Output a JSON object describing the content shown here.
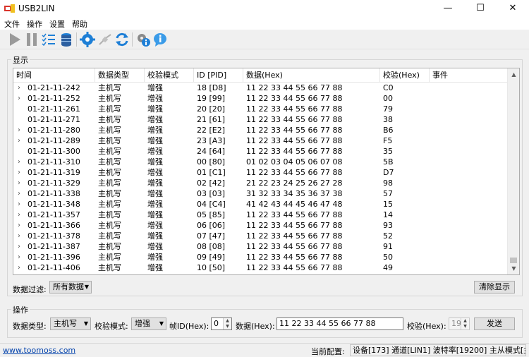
{
  "window": {
    "title": "USB2LIN",
    "minimize": "—",
    "maximize": "☐",
    "close": "✕"
  },
  "menu": [
    "文件",
    "操作",
    "设置",
    "帮助"
  ],
  "toolbar_icons": [
    "play-icon",
    "pause-icon",
    "list-icon",
    "database-icon",
    "gear-icon",
    "plugin-icon",
    "refresh-icon",
    "config-info-icon",
    "about-icon"
  ],
  "display_group": {
    "title": "显示"
  },
  "table": {
    "columns": [
      "时间",
      "数据类型",
      "校验模式",
      "ID [PID]",
      "数据(Hex)",
      "校验(Hex)",
      "事件"
    ],
    "rows": [
      {
        "expandable": true,
        "time": "01-21-11-242",
        "type": "主机写",
        "mode": "增强",
        "id": "18 [D8]",
        "data": "11 22 33 44 55 66 77 88",
        "check": "C0",
        "event": ""
      },
      {
        "expandable": true,
        "time": "01-21-11-252",
        "type": "主机写",
        "mode": "增强",
        "id": "19 [99]",
        "data": "11 22 33 44 55 66 77 88",
        "check": "00",
        "event": ""
      },
      {
        "expandable": false,
        "time": "01-21-11-261",
        "type": "主机写",
        "mode": "增强",
        "id": "20 [20]",
        "data": "11 22 33 44 55 66 77 88",
        "check": "79",
        "event": ""
      },
      {
        "expandable": false,
        "time": "01-21-11-271",
        "type": "主机写",
        "mode": "增强",
        "id": "21 [61]",
        "data": "11 22 33 44 55 66 77 88",
        "check": "38",
        "event": ""
      },
      {
        "expandable": true,
        "time": "01-21-11-280",
        "type": "主机写",
        "mode": "增强",
        "id": "22 [E2]",
        "data": "11 22 33 44 55 66 77 88",
        "check": "B6",
        "event": ""
      },
      {
        "expandable": true,
        "time": "01-21-11-289",
        "type": "主机写",
        "mode": "增强",
        "id": "23 [A3]",
        "data": "11 22 33 44 55 66 77 88",
        "check": "F5",
        "event": ""
      },
      {
        "expandable": false,
        "time": "01-21-11-300",
        "type": "主机写",
        "mode": "增强",
        "id": "24 [64]",
        "data": "11 22 33 44 55 66 77 88",
        "check": "35",
        "event": ""
      },
      {
        "expandable": true,
        "time": "01-21-11-310",
        "type": "主机写",
        "mode": "增强",
        "id": "00 [80]",
        "data": "01 02 03 04 05 06 07 08",
        "check": "5B",
        "event": ""
      },
      {
        "expandable": true,
        "time": "01-21-11-319",
        "type": "主机写",
        "mode": "增强",
        "id": "01 [C1]",
        "data": "11 22 33 44 55 66 77 88",
        "check": "D7",
        "event": ""
      },
      {
        "expandable": true,
        "time": "01-21-11-329",
        "type": "主机写",
        "mode": "增强",
        "id": "02 [42]",
        "data": "21 22 23 24 25 26 27 28",
        "check": "98",
        "event": ""
      },
      {
        "expandable": true,
        "time": "01-21-11-338",
        "type": "主机写",
        "mode": "增强",
        "id": "03 [03]",
        "data": "31 32 33 34 35 36 37 38",
        "check": "57",
        "event": ""
      },
      {
        "expandable": true,
        "time": "01-21-11-348",
        "type": "主机写",
        "mode": "增强",
        "id": "04 [C4]",
        "data": "41 42 43 44 45 46 47 48",
        "check": "15",
        "event": ""
      },
      {
        "expandable": true,
        "time": "01-21-11-357",
        "type": "主机写",
        "mode": "增强",
        "id": "05 [85]",
        "data": "11 22 33 44 55 66 77 88",
        "check": "14",
        "event": ""
      },
      {
        "expandable": true,
        "time": "01-21-11-366",
        "type": "主机写",
        "mode": "增强",
        "id": "06 [06]",
        "data": "11 22 33 44 55 66 77 88",
        "check": "93",
        "event": ""
      },
      {
        "expandable": true,
        "time": "01-21-11-378",
        "type": "主机写",
        "mode": "增强",
        "id": "07 [47]",
        "data": "11 22 33 44 55 66 77 88",
        "check": "52",
        "event": ""
      },
      {
        "expandable": true,
        "time": "01-21-11-387",
        "type": "主机写",
        "mode": "增强",
        "id": "08 [08]",
        "data": "11 22 33 44 55 66 77 88",
        "check": "91",
        "event": ""
      },
      {
        "expandable": true,
        "time": "01-21-11-396",
        "type": "主机写",
        "mode": "增强",
        "id": "09 [49]",
        "data": "11 22 33 44 55 66 77 88",
        "check": "50",
        "event": ""
      },
      {
        "expandable": true,
        "time": "01-21-11-406",
        "type": "主机写",
        "mode": "增强",
        "id": "10 [50]",
        "data": "11 22 33 44 55 66 77 88",
        "check": "49",
        "event": ""
      }
    ]
  },
  "filter": {
    "label": "数据过滤:",
    "value": "所有数据"
  },
  "clear_button": "清除显示",
  "operation_group": {
    "title": "操作",
    "data_type_label": "数据类型:",
    "data_type_value": "主机写",
    "check_mode_label": "校验模式:",
    "check_mode_value": "增强",
    "frame_id_label": "帧ID(Hex):",
    "frame_id_value": "0",
    "data_label": "数据(Hex):",
    "data_value": "11 22 33 44 55 66 77 88",
    "checksum_label": "校验(Hex):",
    "checksum_value": "19",
    "send_button": "发送"
  },
  "status": {
    "link": "www.toomoss.com",
    "config_label": "当前配置:",
    "config_value": "设备[173] 通道[LIN1] 波特率[19200] 主从模式[主机]"
  },
  "colors": {
    "accent_blue": "#1e7fd6",
    "gray_icon": "#8a8a8a",
    "link": "#0645ad"
  }
}
